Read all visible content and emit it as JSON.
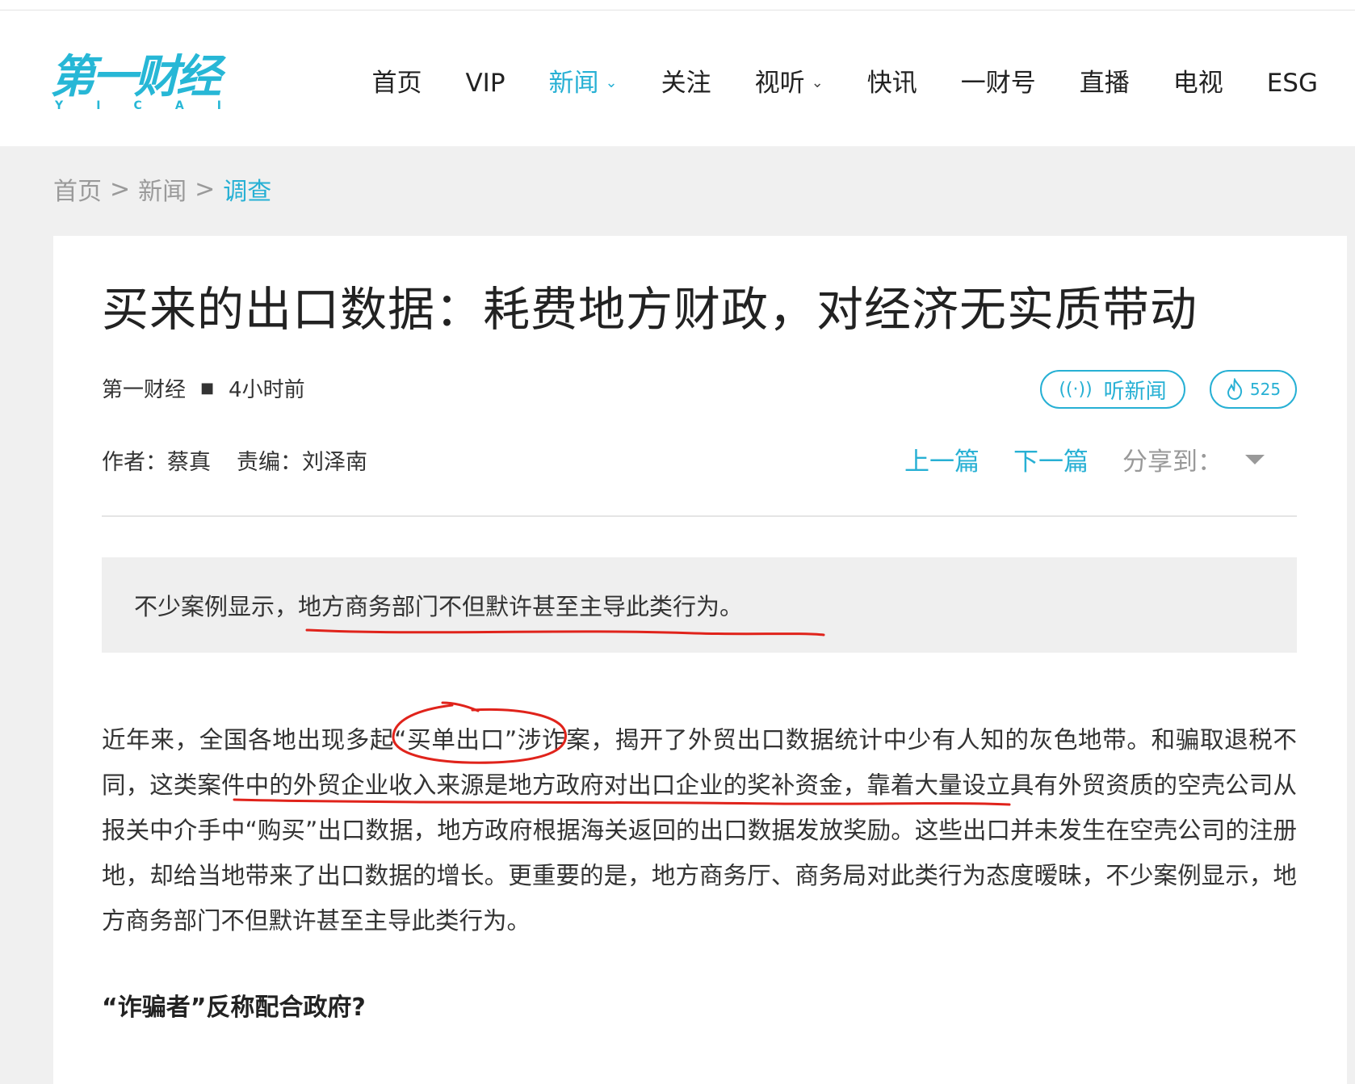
{
  "logo": {
    "main": "第一财经",
    "sub": [
      "Y",
      "I",
      "C",
      "A",
      "I"
    ]
  },
  "nav": [
    {
      "label": "首页",
      "has_dropdown": false,
      "active": false
    },
    {
      "label": "VIP",
      "has_dropdown": false,
      "active": false
    },
    {
      "label": "新闻",
      "has_dropdown": true,
      "active": true
    },
    {
      "label": "关注",
      "has_dropdown": false,
      "active": false
    },
    {
      "label": "视听",
      "has_dropdown": true,
      "active": false
    },
    {
      "label": "快讯",
      "has_dropdown": false,
      "active": false
    },
    {
      "label": "一财号",
      "has_dropdown": false,
      "active": false
    },
    {
      "label": "直播",
      "has_dropdown": false,
      "active": false
    },
    {
      "label": "电视",
      "has_dropdown": false,
      "active": false
    },
    {
      "label": "ESG",
      "has_dropdown": false,
      "active": false
    }
  ],
  "breadcrumb": {
    "items": [
      "首页",
      "新闻"
    ],
    "current": "调查",
    "separator": ">"
  },
  "article": {
    "title": "买来的出口数据：耗费地方财政，对经济无实质带动",
    "source": "第一财经",
    "time": "4小时前",
    "listen_label": "听新闻",
    "hot_count": "525",
    "author": "作者：蔡真",
    "editor": "责编：刘泽南",
    "prev_label": "上一篇",
    "next_label": "下一篇",
    "share_label": "分享到：",
    "summary": "不少案例显示，地方商务部门不但默许甚至主导此类行为。",
    "body": "近年来，全国各地出现多起“买单出口”涉诈案，揭开了外贸出口数据统计中少有人知的灰色地带。和骗取退税不同，这类案件中的外贸企业收入来源是地方政府对出口企业的奖补资金，靠着大量设立具有外贸资质的空壳公司从报关中介手中“购买”出口数据，地方政府根据海关返回的出口数据发放奖励。这些出口并未发生在空壳公司的注册地，却给当地带来了出口数据的增长。更重要的是，地方商务厅、商务局对此类行为态度暧昧，不少案例显示，地方商务部门不但默许甚至主导此类行为。",
    "subhead": "“诈骗者”反称配合政府?"
  },
  "colors": {
    "accent": "#27b0d4",
    "annotation": "#e0231b",
    "summary_bg": "#efefef"
  },
  "icons": {
    "listen": "sound-wave-icon",
    "hot": "flame-icon",
    "share_toggle": "triangle-down-icon",
    "nav_dropdown": "chevron-down-icon"
  }
}
